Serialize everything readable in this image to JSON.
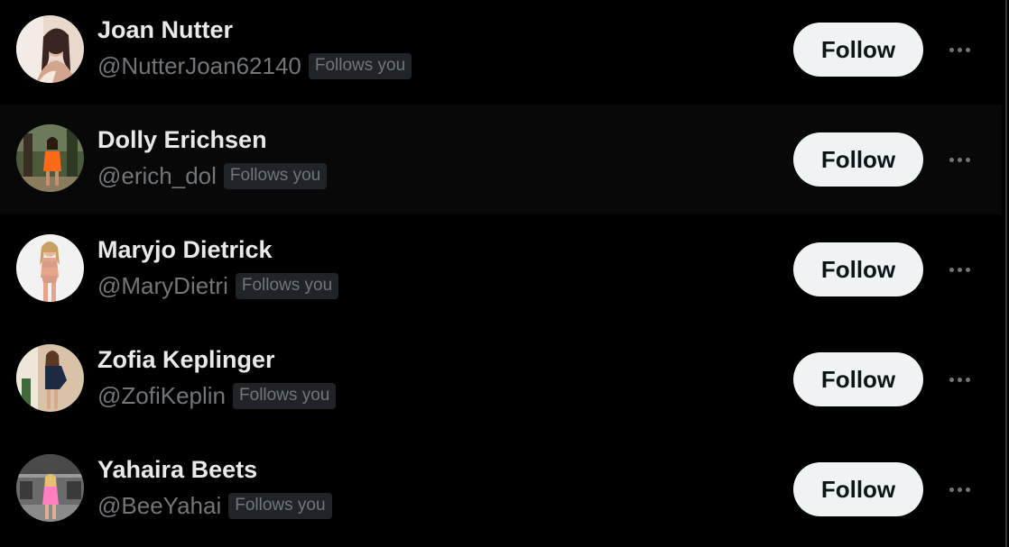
{
  "users": [
    {
      "name": "Joan Nutter",
      "handle": "@NutterJoan62140",
      "badge": "Follows you",
      "button": "Follow",
      "more_icon": "more-horizontal-icon",
      "avatar_bg": "#e8d9cc",
      "avatar_accent": "#3a2620"
    },
    {
      "name": "Dolly Erichsen",
      "handle": "@erich_dol",
      "badge": "Follows you",
      "button": "Follow",
      "more_icon": "more-horizontal-icon",
      "avatar_bg": "#4a5a3a",
      "avatar_accent": "#ff6a1a"
    },
    {
      "name": "Maryjo Dietrick",
      "handle": "@MaryDietri",
      "badge": "Follows you",
      "button": "Follow",
      "more_icon": "more-horizontal-icon",
      "avatar_bg": "#f2f2f2",
      "avatar_accent": "#d99a8a"
    },
    {
      "name": "Zofia Keplinger",
      "handle": "@ZofiKeplin",
      "badge": "Follows you",
      "button": "Follow",
      "more_icon": "more-horizontal-icon",
      "avatar_bg": "#d8c2a8",
      "avatar_accent": "#1e2a44"
    },
    {
      "name": "Yahaira Beets",
      "handle": "@BeeYahai",
      "badge": "Follows you",
      "button": "Follow",
      "more_icon": "more-horizontal-icon",
      "avatar_bg": "#6b6b6b",
      "avatar_accent": "#ff7fc0"
    }
  ],
  "colors": {
    "background": "#000000",
    "hover_row": "#080808",
    "name_text": "#e7e9ea",
    "secondary_text": "#71767b",
    "badge_bg": "#202327",
    "button_bg": "#eff3f4",
    "button_text": "#0f1419"
  }
}
